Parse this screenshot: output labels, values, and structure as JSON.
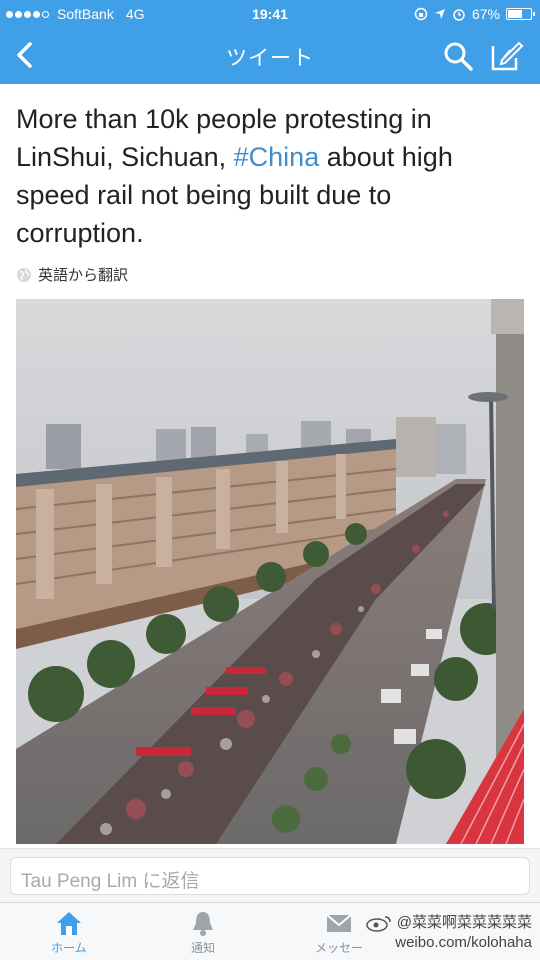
{
  "status_bar": {
    "carrier": "SoftBank",
    "network": "4G",
    "time": "19:41",
    "battery_text": "67%",
    "battery_level": 0.67,
    "signal_bars_filled": 4,
    "signal_bars_total": 5
  },
  "nav": {
    "title": "ツイート",
    "back_icon": "chevron-left-icon",
    "search_icon": "search-icon",
    "compose_icon": "compose-icon"
  },
  "tweet": {
    "text_before": "More than 10k people protesting in LinShui, Sichuan, ",
    "hashtag": "#China",
    "text_after": " about high speed rail not being built due to corruption.",
    "translate_label": "英語から翻訳",
    "hashtag_color": "#3f8fd0"
  },
  "reply": {
    "placeholder": "Tau Peng Lim に返信"
  },
  "tabs": [
    {
      "label": "ホーム",
      "icon": "home-icon",
      "active": true
    },
    {
      "label": "通知",
      "icon": "bell-icon",
      "active": false
    },
    {
      "label": "メッセー",
      "icon": "envelope-icon",
      "active": false
    }
  ],
  "watermark": {
    "line1": "@菜菜啊菜菜菜菜菜",
    "line2": "weibo.com/kolohaha"
  },
  "colors": {
    "accent": "#3fa0e8",
    "text": "#222222"
  }
}
